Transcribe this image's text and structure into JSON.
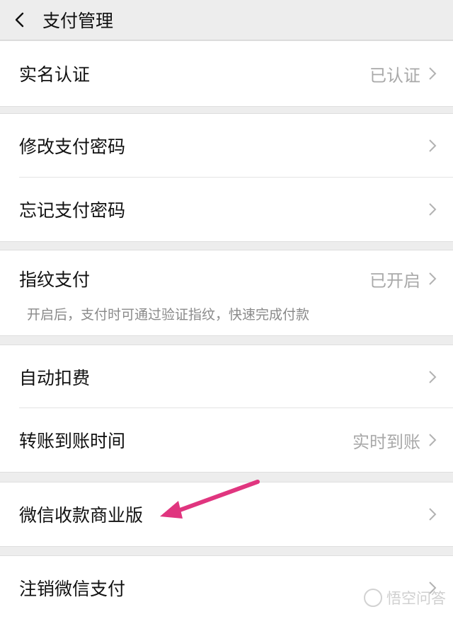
{
  "header": {
    "title": "支付管理"
  },
  "groups": [
    {
      "rows": [
        {
          "label": "实名认证",
          "value": "已认证"
        }
      ]
    },
    {
      "rows": [
        {
          "label": "修改支付密码",
          "value": ""
        },
        {
          "label": "忘记支付密码",
          "value": ""
        }
      ]
    },
    {
      "rows": [
        {
          "label": "指纹支付",
          "value": "已开启",
          "sub": "开启后，支付时可通过验证指纹，快速完成付款"
        }
      ]
    },
    {
      "rows": [
        {
          "label": "自动扣费",
          "value": ""
        },
        {
          "label": "转账到账时间",
          "value": "实时到账"
        }
      ]
    },
    {
      "rows": [
        {
          "label": "微信收款商业版",
          "value": ""
        }
      ]
    },
    {
      "rows": [
        {
          "label": "注销微信支付",
          "value": ""
        }
      ]
    }
  ],
  "annotation": {
    "color": "#e0357f"
  },
  "watermark": {
    "text": "悟空问答"
  },
  "icons": {
    "back": "back-chevron-icon",
    "row": "chevron-right-icon"
  }
}
